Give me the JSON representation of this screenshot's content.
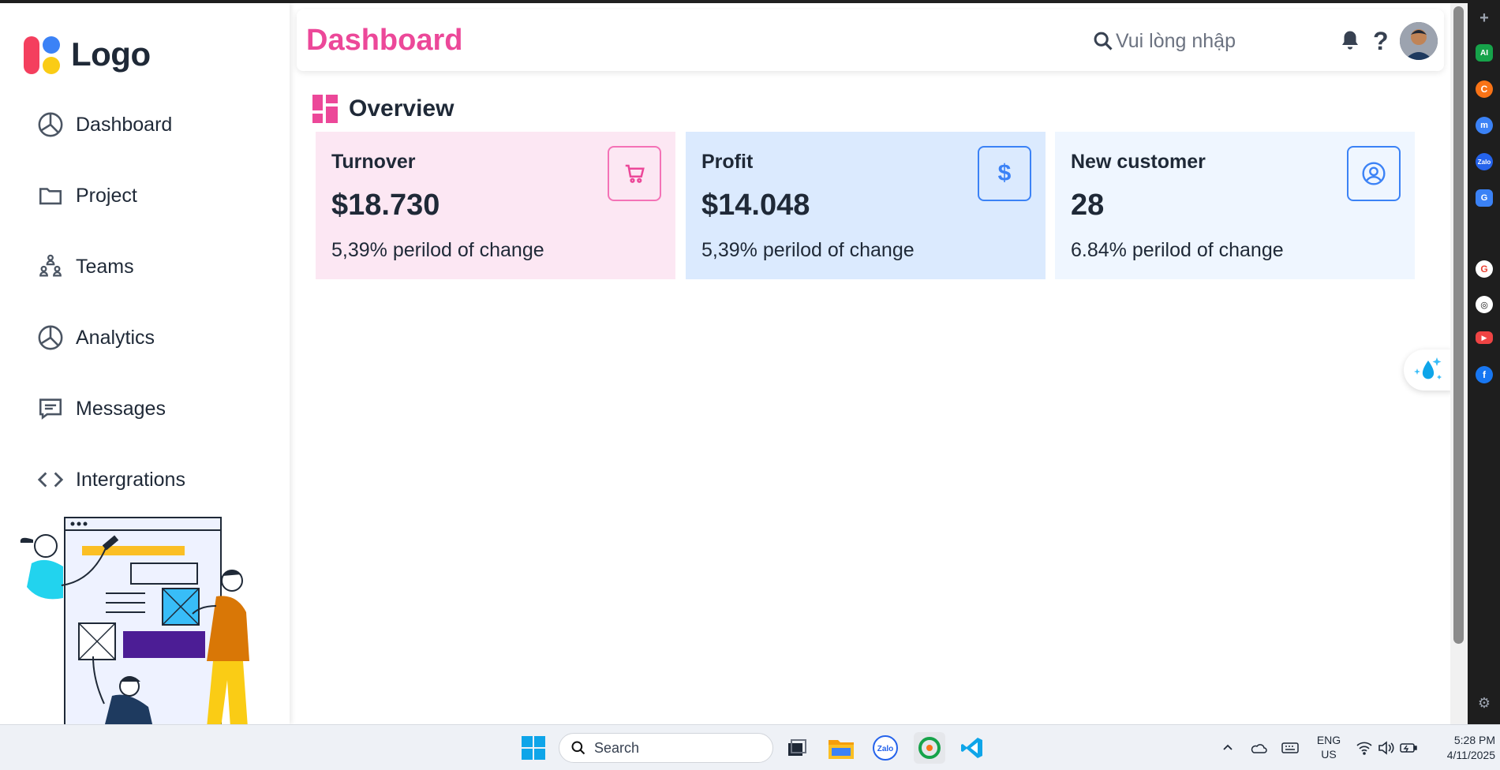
{
  "sidebar": {
    "logo_text": "Logo",
    "items": [
      {
        "label": "Dashboard",
        "icon": "pie-chart-icon"
      },
      {
        "label": "Project",
        "icon": "folder-icon"
      },
      {
        "label": "Teams",
        "icon": "team-icon"
      },
      {
        "label": "Analytics",
        "icon": "pie-chart-icon"
      },
      {
        "label": "Messages",
        "icon": "message-icon"
      },
      {
        "label": "Intergrations",
        "icon": "code-icon"
      }
    ]
  },
  "header": {
    "title": "Dashboard",
    "search_placeholder": "Vui lòng nhập",
    "help_label": "?"
  },
  "overview": {
    "title": "Overview",
    "cards": [
      {
        "title": "Turnover",
        "value": "$18.730",
        "change": "5,39% perilod of change",
        "icon": "cart-icon",
        "bg": "#fce7f3",
        "accent": "#f472b6"
      },
      {
        "title": "Profit",
        "value": "$14.048",
        "change": "5,39% perilod of change",
        "icon": "dollar-icon",
        "bg": "#dbeafe",
        "accent": "#3b82f6"
      },
      {
        "title": "New customer",
        "value": "28",
        "change": "6.84% perilod of change",
        "icon": "user-circle-icon",
        "bg": "#eff6ff",
        "accent": "#3b82f6"
      }
    ]
  },
  "taskbar": {
    "search_label": "Search",
    "lang_line1": "ENG",
    "lang_line2": "US",
    "time": "5:28 PM",
    "date": "4/11/2025"
  },
  "colors": {
    "title_pink": "#ec4899",
    "logo_red": "#f43f5e",
    "logo_blue": "#3b82f6",
    "logo_yellow": "#facc15"
  }
}
